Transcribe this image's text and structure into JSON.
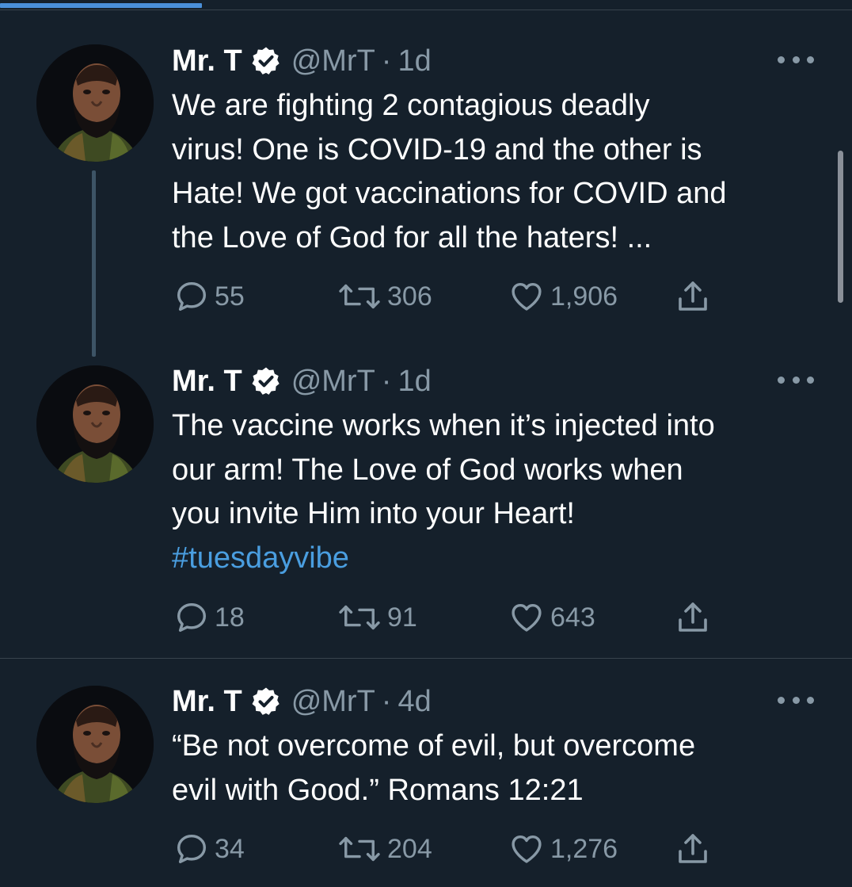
{
  "tweets": [
    {
      "name": "Mr. T",
      "handle": "@MrT",
      "separator": "·",
      "time": "1d",
      "lines": [
        "We are fighting 2 contagious deadly",
        "virus! One is COVID-19 and the other is",
        "Hate! We got vaccinations for COVID and",
        "the Love of God for all the haters! ..."
      ],
      "hashtag": "",
      "replies": "55",
      "retweets": "306",
      "likes": "1,906"
    },
    {
      "name": "Mr. T",
      "handle": "@MrT",
      "separator": "·",
      "time": "1d",
      "lines": [
        "The vaccine works when it’s injected into",
        "our arm! The Love of God works when",
        "you invite Him into your Heart!"
      ],
      "hashtag": "#tuesdayvibe",
      "replies": "18",
      "retweets": "91",
      "likes": "643"
    },
    {
      "name": "Mr. T",
      "handle": "@MrT",
      "separator": "·",
      "time": "4d",
      "lines": [
        "“Be not overcome of evil, but overcome",
        "evil with Good.” Romans 12:21"
      ],
      "hashtag": "",
      "replies": "34",
      "retweets": "204",
      "likes": "1,276"
    }
  ],
  "icons": {
    "verified": "verified-badge-icon",
    "more": "more-dots-icon",
    "reply": "reply-bubble-icon",
    "retweet": "retweet-arrows-icon",
    "like": "heart-icon",
    "share": "share-upload-icon"
  },
  "colors": {
    "background": "#15202b",
    "text": "#ffffff",
    "secondary": "#8899a6",
    "accent": "#4a9ee0",
    "divider": "#38444d"
  }
}
